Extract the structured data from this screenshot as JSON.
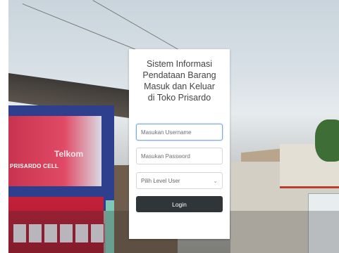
{
  "login": {
    "title": "Sistem Informasi\nPendataan Barang\nMasuk dan Keluar\ndi Toko Prisardo",
    "username_placeholder": "Masukan Username",
    "password_placeholder": "Masukan Password",
    "level_select_value": "Pilih Level User",
    "login_label": "Login"
  },
  "background": {
    "telkom_sign": "Telkom",
    "shop_sign": "PRISARDO CELL"
  },
  "colors": {
    "card": "#ffffff",
    "button": "#303539",
    "focus_border": "#7fa8d8"
  },
  "icons": {
    "select_arrow": "chevron-down-icon"
  }
}
